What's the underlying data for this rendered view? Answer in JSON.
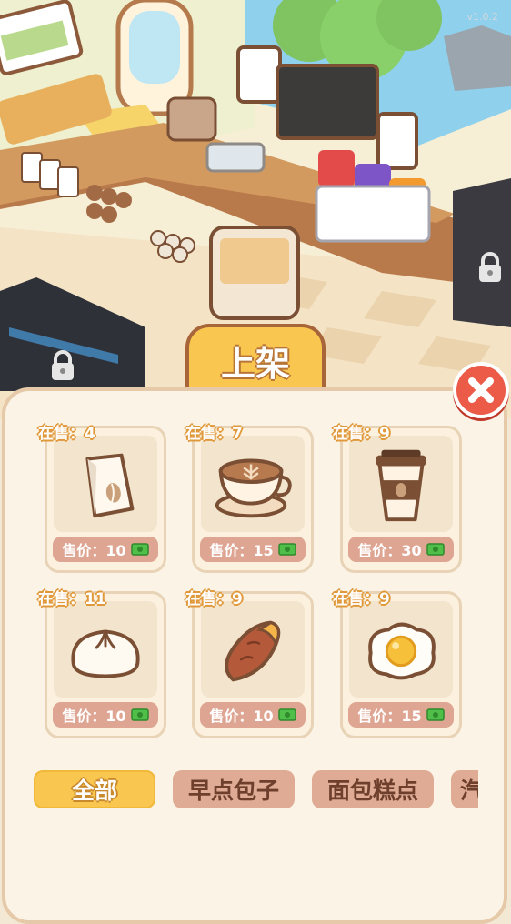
{
  "version": "v1.0.2",
  "panel": {
    "title": "上架"
  },
  "items": [
    {
      "stock_label": "在售：4",
      "price_label": "售价：10",
      "icon": "coffee-bean-bag-icon"
    },
    {
      "stock_label": "在售：7",
      "price_label": "售价：15",
      "icon": "latte-cup-icon"
    },
    {
      "stock_label": "在售：9",
      "price_label": "售价：30",
      "icon": "takeaway-coffee-icon"
    },
    {
      "stock_label": "在售：11",
      "price_label": "售价：10",
      "icon": "steamed-bun-icon"
    },
    {
      "stock_label": "在售：9",
      "price_label": "售价：10",
      "icon": "sweet-potato-icon"
    },
    {
      "stock_label": "在售：9",
      "price_label": "售价：15",
      "icon": "fried-egg-icon"
    }
  ],
  "categories": [
    {
      "label": "全部",
      "active": true
    },
    {
      "label": "早点包子",
      "active": false
    },
    {
      "label": "面包糕点",
      "active": false
    },
    {
      "label": "汽",
      "active": false
    }
  ],
  "colors": {
    "accent": "#f9c650",
    "close": "#ec5a48",
    "price_tag": "#dfa593",
    "cash": "#4fbf4a"
  }
}
